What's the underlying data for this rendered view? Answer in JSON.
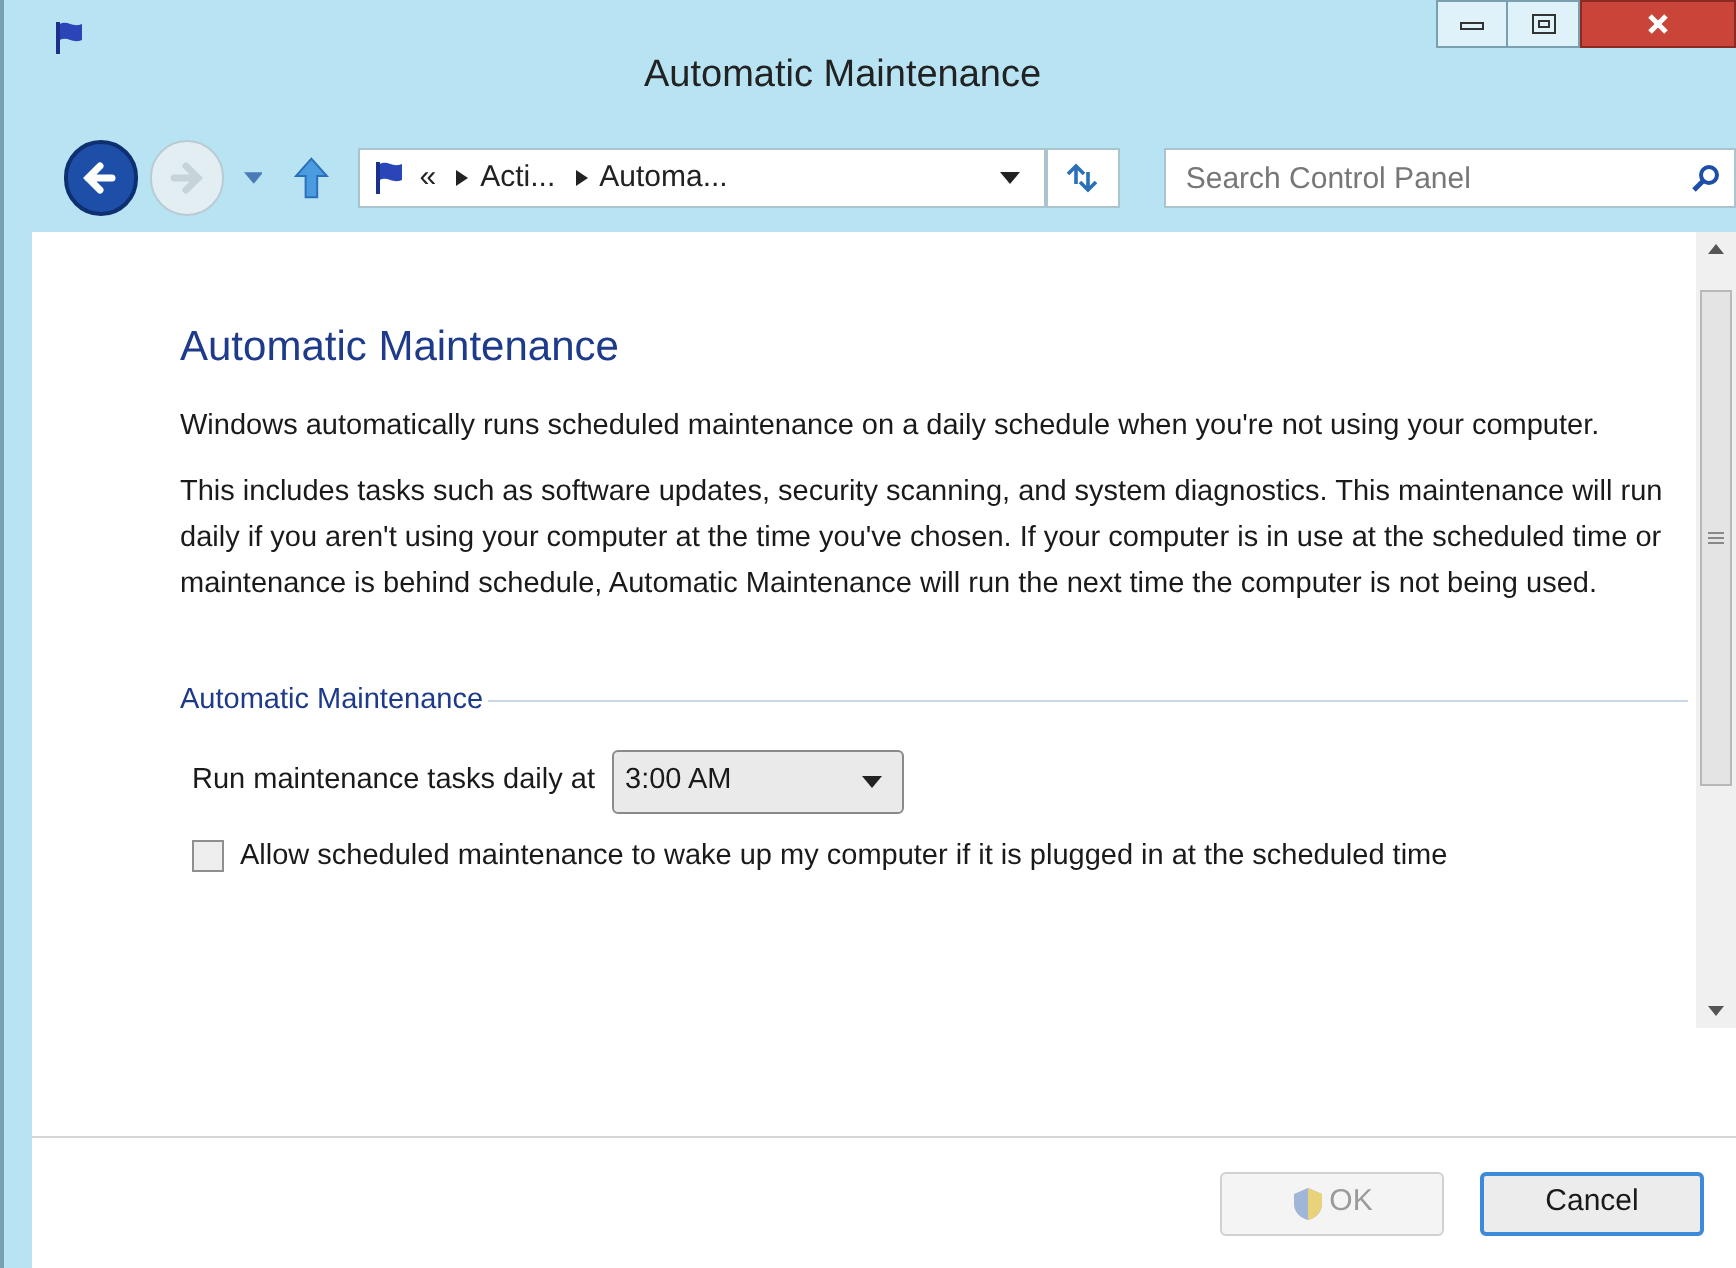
{
  "window": {
    "title": "Automatic Maintenance"
  },
  "nav_buttons": [
    {
      "kind": "back",
      "disabled": false
    },
    {
      "kind": "forward",
      "disabled": true
    }
  ],
  "address_bar": {
    "overflow": "«",
    "crumbs": [
      "Acti...",
      "Automa..."
    ]
  },
  "search": {
    "placeholder": "Search Control Panel"
  },
  "heading": "Automatic Maintenance",
  "paragraphs": [
    "Windows automatically runs scheduled maintenance on a daily schedule when you're not using your computer.",
    "This includes tasks such as software updates, security scanning, and system diagnostics. This maintenance will run daily if you aren't using your computer at the time you've chosen. If your computer is in use at the scheduled time or maintenance is behind schedule, Automatic Maintenance will run the next time the computer is not being used."
  ],
  "group": {
    "title": "Automatic Maintenance",
    "schedule_label": "Run maintenance tasks daily at",
    "time": "3:00 AM",
    "wake": {
      "label": "Allow scheduled maintenance to wake up my computer if it is plugged in at the scheduled time",
      "checked": false
    }
  },
  "buttons": [
    {
      "label": "OK",
      "kind": "shield",
      "disabled": true,
      "focused": false
    },
    {
      "label": "Cancel",
      "kind": "plain",
      "disabled": false,
      "focused": true
    }
  ]
}
